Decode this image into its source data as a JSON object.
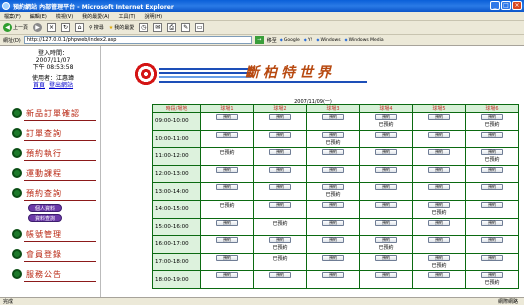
{
  "window": {
    "title": "預約網站 內部管理平台 - Microsoft Internet Explorer",
    "buttons": [
      "_",
      "□",
      "×"
    ]
  },
  "menu": [
    "檔案(F)",
    "編輯(E)",
    "檢視(V)",
    "我的最愛(A)",
    "工具(T)",
    "說明(H)"
  ],
  "toolbar": {
    "back": "上一頁",
    "search": "搜尋",
    "favorites": "我的最愛"
  },
  "address": {
    "label": "網址(D)",
    "url": "http://127.0.0.1/phpweb/index2.asp",
    "go": "→",
    "go_label": "移至",
    "links": [
      "Google",
      "Y!",
      "Windows",
      "Windows Media"
    ]
  },
  "user": {
    "login_label": "登入時間：",
    "login_date": "2007/11/07",
    "login_time": "下午 08:53:58",
    "user_label": "使用者：江惠瑋",
    "link_home": "首頁",
    "link_logout": "登出網站"
  },
  "nav": {
    "items": [
      "新品訂單確認",
      "訂單查詢",
      "預約執行",
      "運動課程",
      "預約查詢",
      "帳號管理",
      "會員登錄",
      "服務公告"
    ],
    "sub_buttons": [
      "個人資料",
      "資料查詢"
    ]
  },
  "banner": {
    "title": "斷柏特世界"
  },
  "schedule": {
    "date_caption": "2007/11/09(一)",
    "corner_header": "時段/場地",
    "columns": [
      "球場1",
      "球場2",
      "球場3",
      "球場4",
      "球場5",
      "球場6"
    ],
    "reserve_label": "預約",
    "booked_label": "已預約",
    "rows": [
      {
        "time": "09:00-10:00",
        "cells": [
          "r",
          "r",
          "r",
          "rb",
          "r",
          "rb"
        ]
      },
      {
        "time": "10:00-11:00",
        "cells": [
          "r",
          "r",
          "rb",
          "r",
          "r",
          "r"
        ]
      },
      {
        "time": "11:00-12:00",
        "cells": [
          "b",
          "r",
          "r",
          "r",
          "r",
          "rb"
        ]
      },
      {
        "time": "12:00-13:00",
        "cells": [
          "r",
          "r",
          "r",
          "r",
          "r",
          "r"
        ]
      },
      {
        "time": "13:00-14:00",
        "cells": [
          "r",
          "r",
          "rb",
          "r",
          "r",
          "r"
        ]
      },
      {
        "time": "14:00-15:00",
        "cells": [
          "b",
          "r",
          "r",
          "r",
          "rb",
          "r"
        ]
      },
      {
        "time": "15:00-16:00",
        "cells": [
          "r",
          "b",
          "r",
          "r",
          "r",
          "r"
        ]
      },
      {
        "time": "16:00-17:00",
        "cells": [
          "r",
          "rb",
          "r",
          "rb",
          "r",
          "r"
        ]
      },
      {
        "time": "17:00-18:00",
        "cells": [
          "r",
          "b",
          "r",
          "r",
          "rb",
          "r"
        ]
      },
      {
        "time": "18:00-19:00",
        "cells": [
          "r",
          "r",
          "r",
          "r",
          "r",
          "rb"
        ]
      }
    ]
  },
  "status": {
    "left": "完成",
    "right": "網際網路"
  },
  "colors": {
    "nav_text": "#b82510",
    "table_border": "#0b6a11",
    "header_text": "#c4302b",
    "banner_text": "#b84a11"
  }
}
